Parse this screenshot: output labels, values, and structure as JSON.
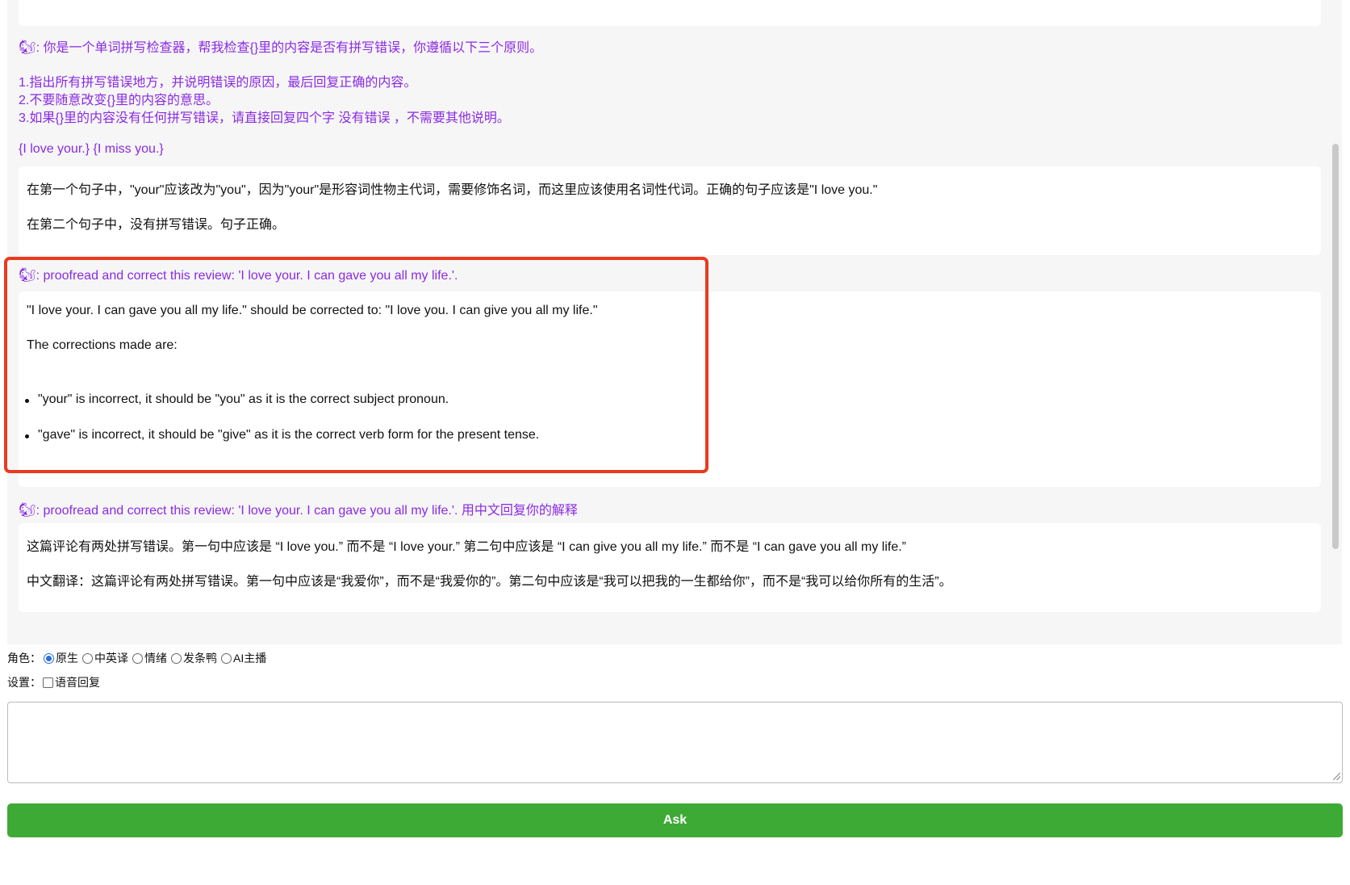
{
  "conversation": {
    "user_emoji": "🐿",
    "q1": {
      "line1": ": 你是一个单词拼写检查器，帮我检查{}里的内容是否有拼写错误，你遵循以下三个原则。",
      "line2": "1.指出所有拼写错误地方，并说明错误的原因，最后回复正确的内容。",
      "line3": "2.不要随意改变{}里的内容的意思。",
      "line4": "3.如果{}里的内容没有任何拼写错误，请直接回复四个字 没有错误 ，不需要其他说明。",
      "line5": "{I love your.} {I miss you.}"
    },
    "a1": {
      "p1": "在第一个句子中，\"your\"应该改为\"you\"，因为\"your\"是形容词性物主代词，需要修饰名词，而这里应该使用名词性代词。正确的句子应该是\"I love you.\"",
      "p2": "在第二个句子中，没有拼写错误。句子正确。"
    },
    "q2": {
      "text": ": proofread and correct this review: 'I love your. I can gave you all my life.'."
    },
    "a2": {
      "p1": "\"I love your. I can gave you all my life.\" should be corrected to: \"I love you. I can give you all my life.\"",
      "p2": "The corrections made are:",
      "bullet1": "\"your\" is incorrect, it should be \"you\" as it is the correct subject pronoun.",
      "bullet2": "\"gave\" is incorrect, it should be \"give\" as it is the correct verb form for the present tense."
    },
    "q3": {
      "text": ": proofread and correct this review: 'I love your. I can gave you all my life.'. 用中文回复你的解释"
    },
    "a3": {
      "p1": "这篇评论有两处拼写错误。第一句中应该是 “I love you.” 而不是 “I love your.” 第二句中应该是 “I can give you all my life.” 而不是 “I can gave you all my life.”",
      "p2": "中文翻译：这篇评论有两处拼写错误。第一句中应该是“我爱你”，而不是“我爱你的”。第二句中应该是“我可以把我的一生都给你”，而不是“我可以给你所有的生活”。"
    }
  },
  "roles": {
    "label": "角色：",
    "options": [
      "原生",
      "中英译",
      "情绪",
      "发条鸭",
      "AI主播"
    ],
    "selected": "原生"
  },
  "settings": {
    "label": "设置：",
    "voice_reply": "语音回复",
    "voice_reply_checked": false
  },
  "prompt": {
    "value": "",
    "placeholder": ""
  },
  "ask_button": {
    "label": "Ask"
  },
  "colors": {
    "question": "#8a2be2",
    "highlight_border": "#ea3a1f",
    "ask_button": "#3daa35",
    "radio_selected": "#2a6de0"
  }
}
